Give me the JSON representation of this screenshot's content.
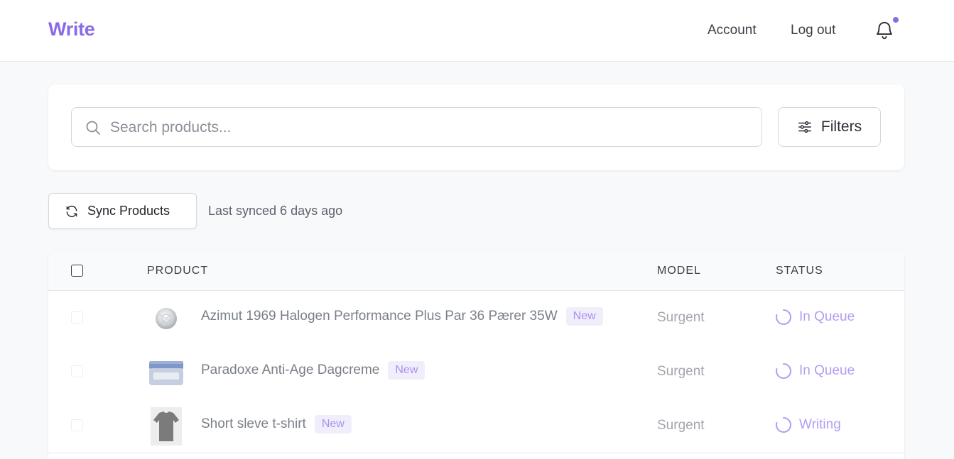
{
  "brand": "Write",
  "nav": {
    "account": "Account",
    "logout": "Log out"
  },
  "search": {
    "placeholder": "Search products...",
    "value": ""
  },
  "filters_label": "Filters",
  "sync": {
    "button_label": "Sync Products",
    "last_synced": "Last synced 6 days ago"
  },
  "table": {
    "columns": {
      "product": "PRODUCT",
      "model": "MODEL",
      "status": "STATUS"
    },
    "rows": [
      {
        "name": "Azimut 1969 Halogen Performance Plus Par 36 Pærer 35W",
        "badge": "New",
        "model": "Surgent",
        "status": "In Queue",
        "thumb_icon": "halogen-bulb-icon"
      },
      {
        "name": "Paradoxe Anti-Age Dagcreme",
        "badge": "New",
        "model": "Surgent",
        "status": "In Queue",
        "thumb_icon": "cream-jar-icon"
      },
      {
        "name": "Short sleve t-shirt",
        "badge": "New",
        "model": "Surgent",
        "status": "Writing",
        "thumb_icon": "t-shirt-icon"
      }
    ]
  },
  "colors": {
    "accent": "#8a6be6",
    "status": "#b39df2",
    "badge_bg": "#f1eefc"
  }
}
